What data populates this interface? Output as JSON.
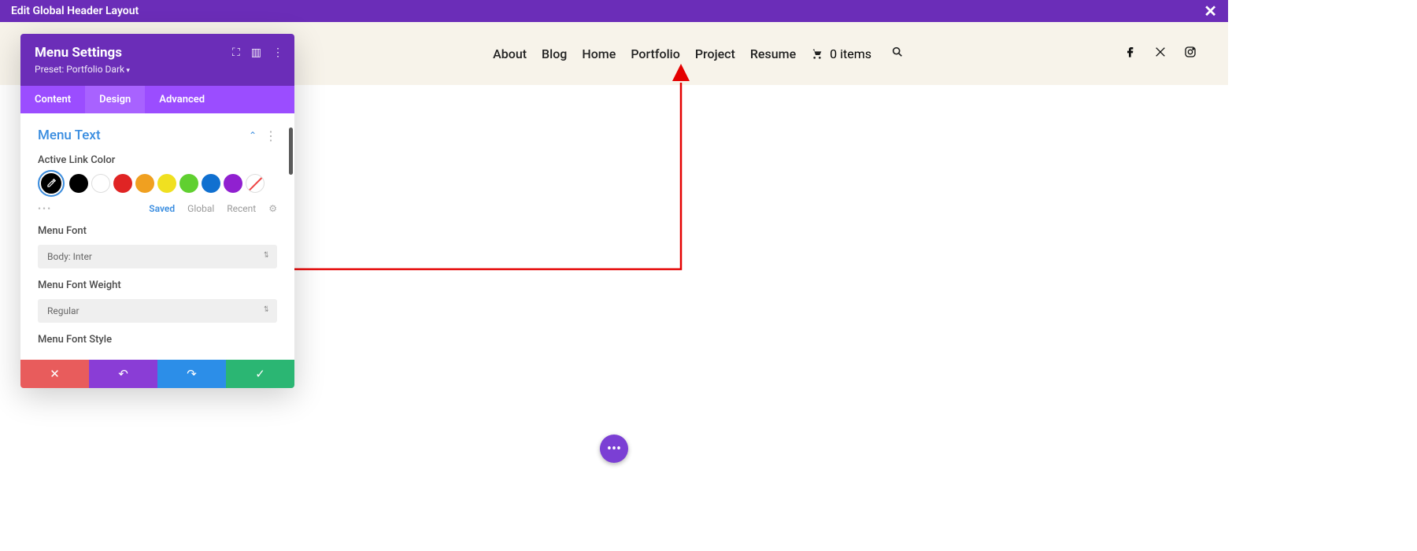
{
  "topbar": {
    "title": "Edit Global Header Layout"
  },
  "nav": {
    "items": [
      "About",
      "Blog",
      "Home",
      "Portfolio",
      "Project",
      "Resume"
    ],
    "cart_label": "0 items"
  },
  "panel": {
    "title": "Menu Settings",
    "preset": "Preset: Portfolio Dark",
    "tabs": [
      "Content",
      "Design",
      "Advanced"
    ],
    "active_tab": 1,
    "section_title": "Menu Text",
    "active_link_color_label": "Active Link Color",
    "swatches": {
      "selected_bg": "#000000",
      "colors": [
        "#000000",
        "#ffffff",
        "#e02424",
        "#f0a020",
        "#f0e020",
        "#60d030",
        "#1070d0",
        "#9020d0"
      ]
    },
    "palette_tabs": {
      "saved": "Saved",
      "global": "Global",
      "recent": "Recent"
    },
    "menu_font_label": "Menu Font",
    "menu_font_value": "Body: Inter",
    "menu_font_weight_label": "Menu Font Weight",
    "menu_font_weight_value": "Regular",
    "menu_font_style_label": "Menu Font Style"
  }
}
